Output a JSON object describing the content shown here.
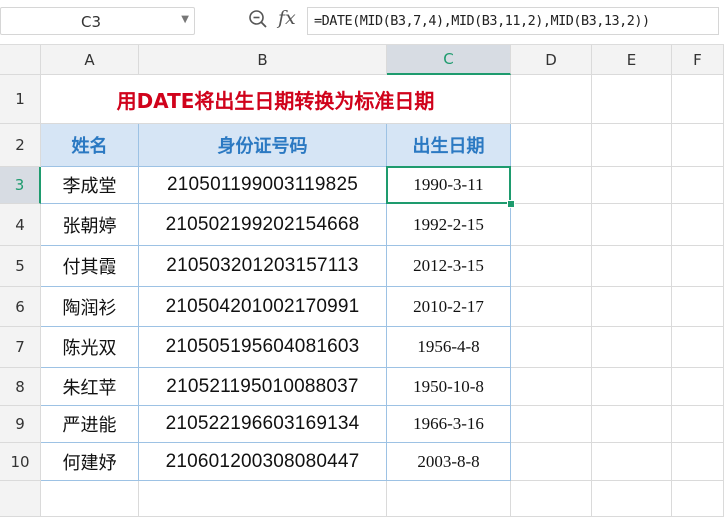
{
  "formula_bar": {
    "cell_ref": "C3",
    "fx_label": "fx",
    "formula": "=DATE(MID(B3,7,4),MID(B3,11,2),MID(B3,13,2))"
  },
  "columns": [
    "A",
    "B",
    "C",
    "D",
    "E",
    "F"
  ],
  "selected_column": "C",
  "row_numbers": [
    "1",
    "2",
    "3",
    "4",
    "5",
    "6",
    "7",
    "8",
    "9",
    "10"
  ],
  "selected_row": "3",
  "title": "用DATE将出生日期转换为标准日期",
  "headers": {
    "name": "姓名",
    "id": "身份证号码",
    "birth": "出生日期"
  },
  "rows": [
    {
      "name": "李成堂",
      "id": "210501199003119825",
      "birth": "1990-3-11"
    },
    {
      "name": "张朝婷",
      "id": "210502199202154668",
      "birth": "1992-2-15"
    },
    {
      "name": "付其霞",
      "id": "210503201203157113",
      "birth": "2012-3-15"
    },
    {
      "name": "陶润衫",
      "id": "210504201002170991",
      "birth": "2010-2-17"
    },
    {
      "name": "陈光双",
      "id": "210505195604081603",
      "birth": "1956-4-8"
    },
    {
      "name": "朱红苹",
      "id": "210521195010088037",
      "birth": "1950-10-8"
    },
    {
      "name": "严进能",
      "id": "210522196603169134",
      "birth": "1966-3-16"
    },
    {
      "name": "何建妤",
      "id": "210601200308080447",
      "birth": "2003-8-8"
    }
  ]
}
